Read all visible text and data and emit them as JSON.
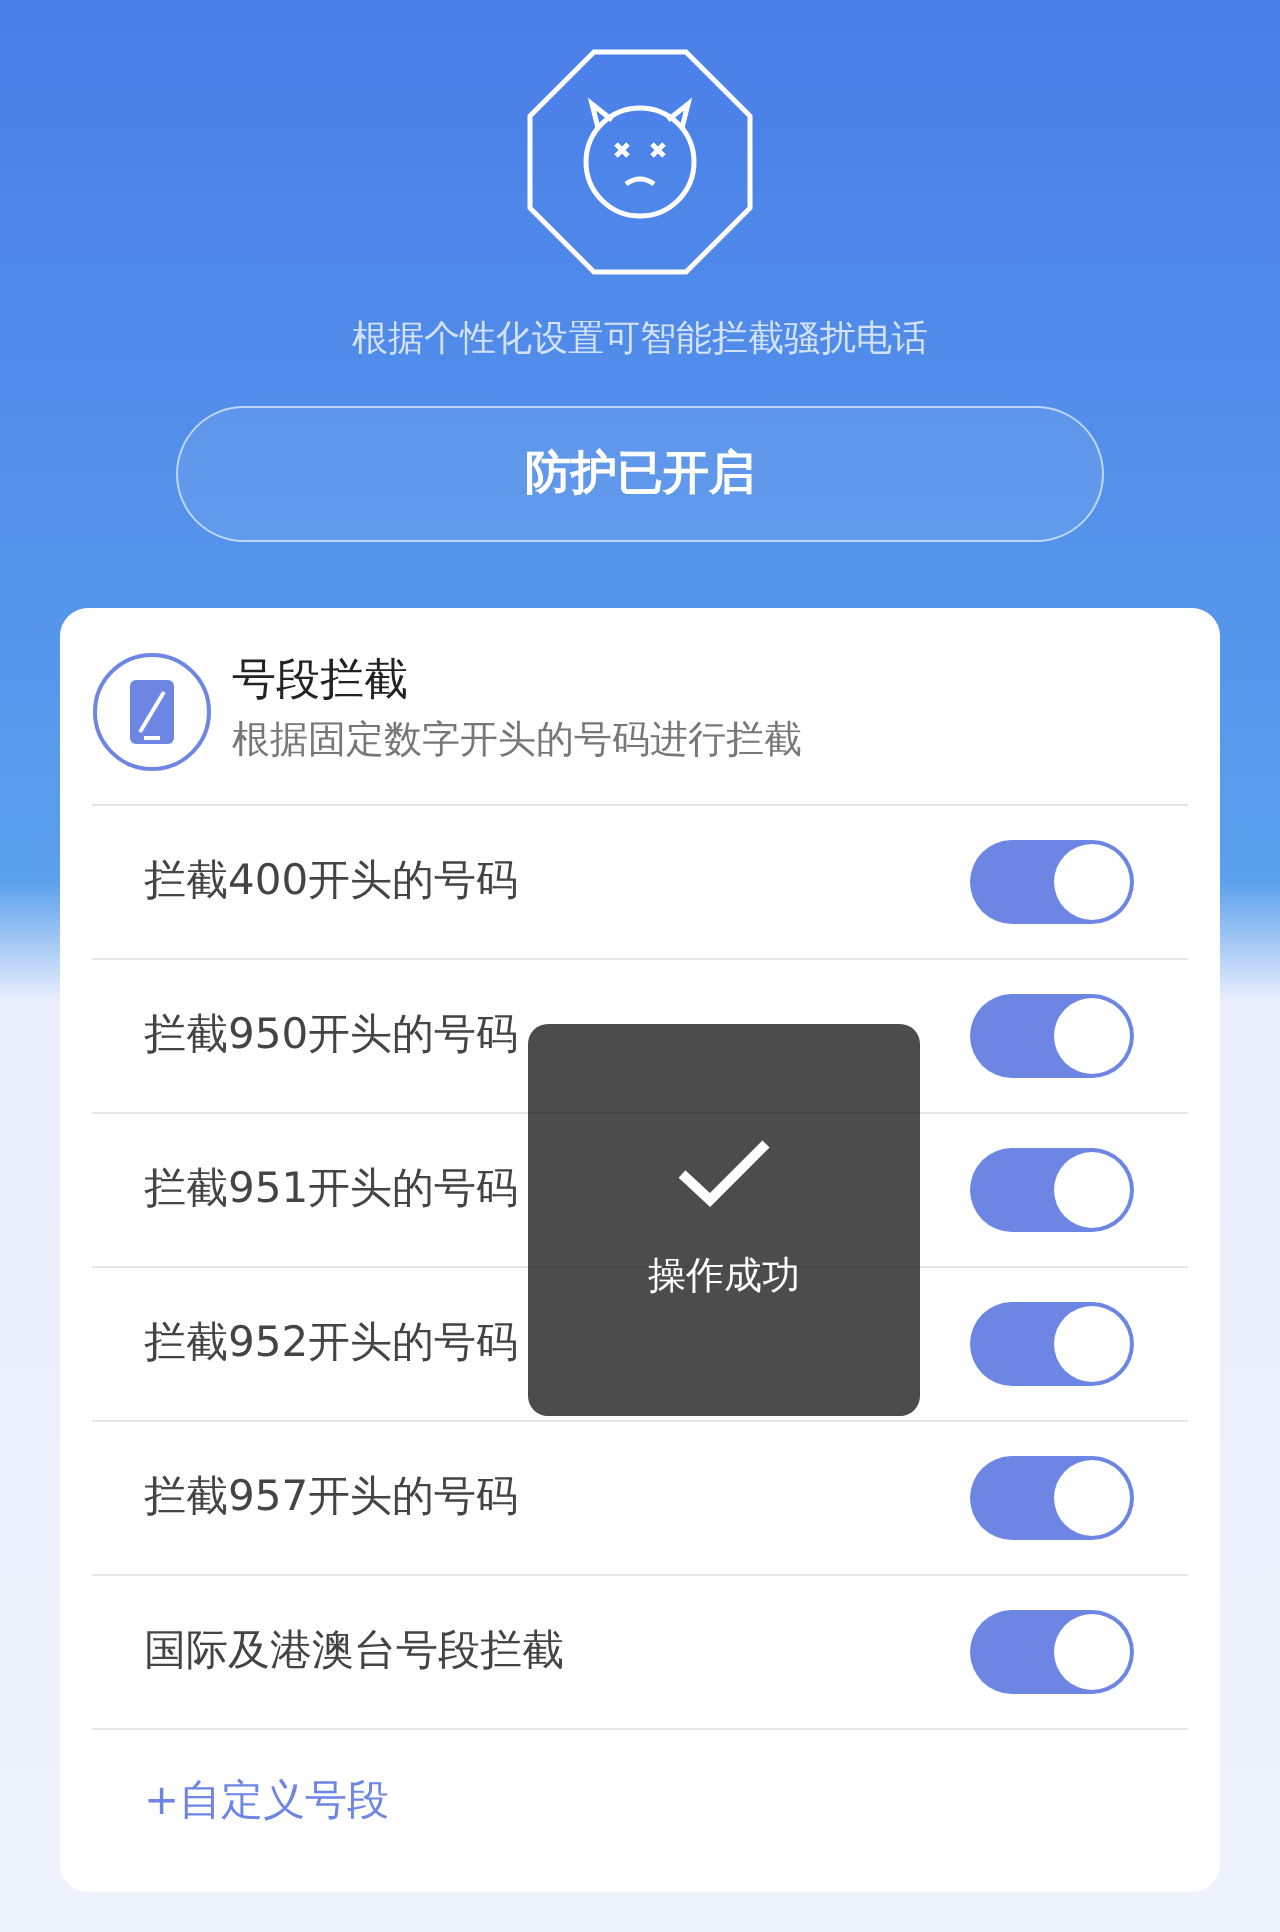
{
  "header": {
    "subtitle": "根据个性化设置可智能拦截骚扰电话",
    "protection_button": "防护已开启"
  },
  "card": {
    "title": "号段拦截",
    "subtitle": "根据固定数字开头的号码进行拦截",
    "rules": [
      {
        "label": "拦截400开头的号码",
        "on": true
      },
      {
        "label": "拦截950开头的号码",
        "on": true
      },
      {
        "label": "拦截951开头的号码",
        "on": true
      },
      {
        "label": "拦截952开头的号码",
        "on": true
      },
      {
        "label": "拦截957开头的号码",
        "on": true
      },
      {
        "label": "国际及港澳台号段拦截",
        "on": true
      }
    ],
    "add_link": "+自定义号段"
  },
  "toast": {
    "message": "操作成功"
  }
}
